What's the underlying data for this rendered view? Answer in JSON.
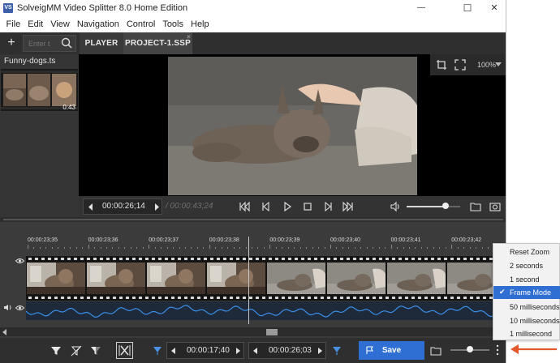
{
  "window": {
    "title": "SolveigMM Video Splitter 8.0 Home Edition",
    "app_icon_text": "VS",
    "minimize_glyph": "—",
    "maximize_glyph": "☐",
    "close_glyph": "✕"
  },
  "menu": {
    "items": [
      "File",
      "Edit",
      "View",
      "Navigation",
      "Control",
      "Tools",
      "Help"
    ]
  },
  "toolbar": {
    "plus_label": "+",
    "search_placeholder": "Enter t",
    "tabs": [
      {
        "label": "PLAYER",
        "active": false
      },
      {
        "label": "PROJECT-1.SSP",
        "active": true,
        "close_glyph": "×"
      }
    ]
  },
  "media": {
    "file_name": "Funny-dogs.ts",
    "thumb_duration": "0:43"
  },
  "player": {
    "zoom": "100%",
    "current_time": "00:00:26;14",
    "total_time": "/ 00:00:43;24",
    "volume_level": 0.72
  },
  "timeline": {
    "ticks": [
      "00:00:23;35",
      "00:00:23;36",
      "00:00:23;37",
      "00:00:23;38",
      "00:00:23;39",
      "00:00:23;40",
      "00:00:23;41",
      "00:00:23;42"
    ],
    "frame_count": 8
  },
  "bottom": {
    "marker_in_time": "00:00:17;40",
    "marker_out_time": "00:00:26;03",
    "save_label": "Save"
  },
  "zoom_menu": {
    "items": [
      {
        "label": "Reset Zoom",
        "selected": false
      },
      {
        "label": "2 seconds",
        "selected": false
      },
      {
        "label": "1 second",
        "selected": false
      },
      {
        "label": "Frame Mode",
        "selected": true
      },
      {
        "label": "50 milliseconds",
        "selected": false
      },
      {
        "label": "10 milliseconds",
        "selected": false
      },
      {
        "label": "1 millisecond",
        "selected": false
      }
    ],
    "check_glyph": "✔"
  },
  "colors": {
    "accent": "#2f6ed3",
    "arrow": "#e2592d",
    "waveform": "#3a8ee6"
  }
}
